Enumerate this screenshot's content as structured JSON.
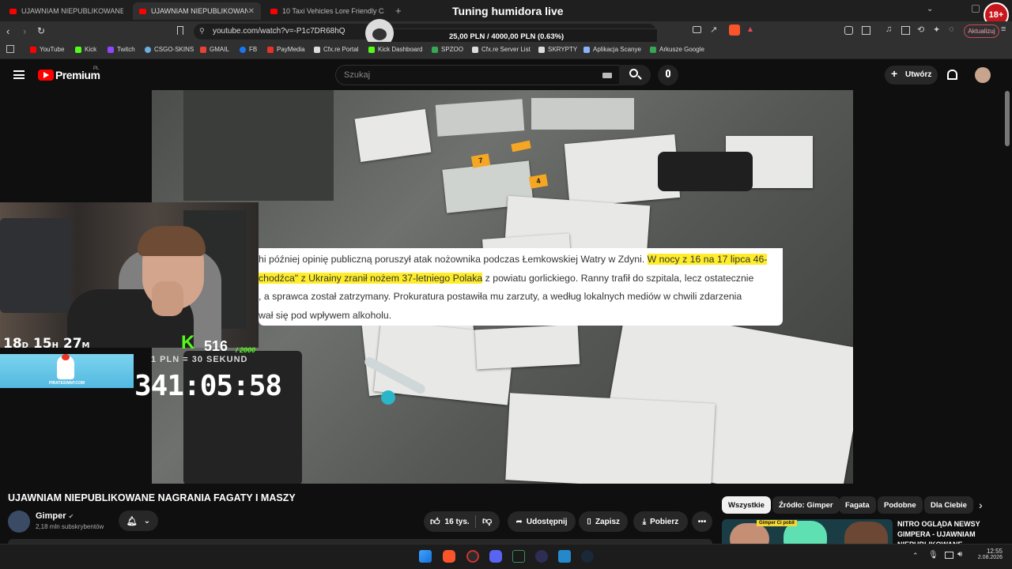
{
  "browser": {
    "tabs": [
      {
        "label": "UJAWNIAM NIEPUBLIKOWANE NAG"
      },
      {
        "label": "UJAWNIAM NIEPUBLIKOWAN"
      },
      {
        "label": "10 Taxi Vehicles Lore Friendly Cars GT"
      }
    ],
    "url": "youtube.com/watch?v=-P1c7DR68hQ",
    "update_label": "Aktualizuj",
    "bookmarks": [
      "YouTube",
      "Kick",
      "Twitch",
      "CSGO-SKINS",
      "GMAIL",
      "FB",
      "PayMedia",
      "Cfx.re Portal",
      "Kick Dashboard",
      "SPZOO",
      "Cfx.re Server List",
      "SKRYPTY",
      "Aplikacja Scanye",
      "Arkusze Google"
    ]
  },
  "stream": {
    "title": "Tuning humidora live",
    "goal": "25,00 PLN / 4000,00 PLN (0.63%)",
    "badge": "18+",
    "uptime": {
      "d": "18",
      "h": "15",
      "m": "27",
      "d_unit": "D",
      "h_unit": "H",
      "m_unit": "M"
    },
    "kick_count": "516",
    "kick_max": "/ 2000",
    "rate": "1 PLN = 30 SEKUND",
    "timer": "341:05:58",
    "sponsor": "PIRATESWAP.COM"
  },
  "youtube": {
    "logo": "Premium",
    "logo_sup": "PL",
    "search_placeholder": "Szukaj",
    "create_label": "Utwórz",
    "video_title": "UJAWNIAM NIEPUBLIKOWANE NAGRANIA FAGATY I MASZY",
    "channel": "Gimper",
    "subscribers": "2,18 mln subskrybentów",
    "likes": "16 tys.",
    "share": "Udostępnij",
    "save": "Zapisz",
    "download": "Pobierz",
    "chips": [
      "Wszystkie",
      "Źródło: Gimper",
      "Fagata",
      "Podobne",
      "Dla Ciebie"
    ],
    "rec_title": "NITRO OGLĄDA NEWSY GIMPERA - UJAWNIAM NIEPUBLIKOWANE",
    "rec_tag": "Gimper Ci pobił",
    "article": {
      "line1_a": "hi później opinię publiczną poruszył atak nożownika podczas Łemkowskiej Watry w Zdyni. ",
      "line1_hl": "W nocy z 16 na 17 lipca 46-",
      "line2_hl": "chodźca\" z Ukrainy zranił nożem 37-letniego Polaka",
      "line2_b": " z powiatu gorlickiego. Ranny trafił do szpitala, lecz ostatecznie",
      "line3": ", a sprawca został zatrzymany. Prokuratura postawiła mu zarzuty, a według lokalnych mediów w chwili zdarzenia",
      "line4": "wał się pod wpływem alkoholu."
    },
    "evidence_markers": [
      "7",
      "4"
    ]
  },
  "taskbar": {
    "time": "12:55",
    "date": "2.08.2026"
  }
}
